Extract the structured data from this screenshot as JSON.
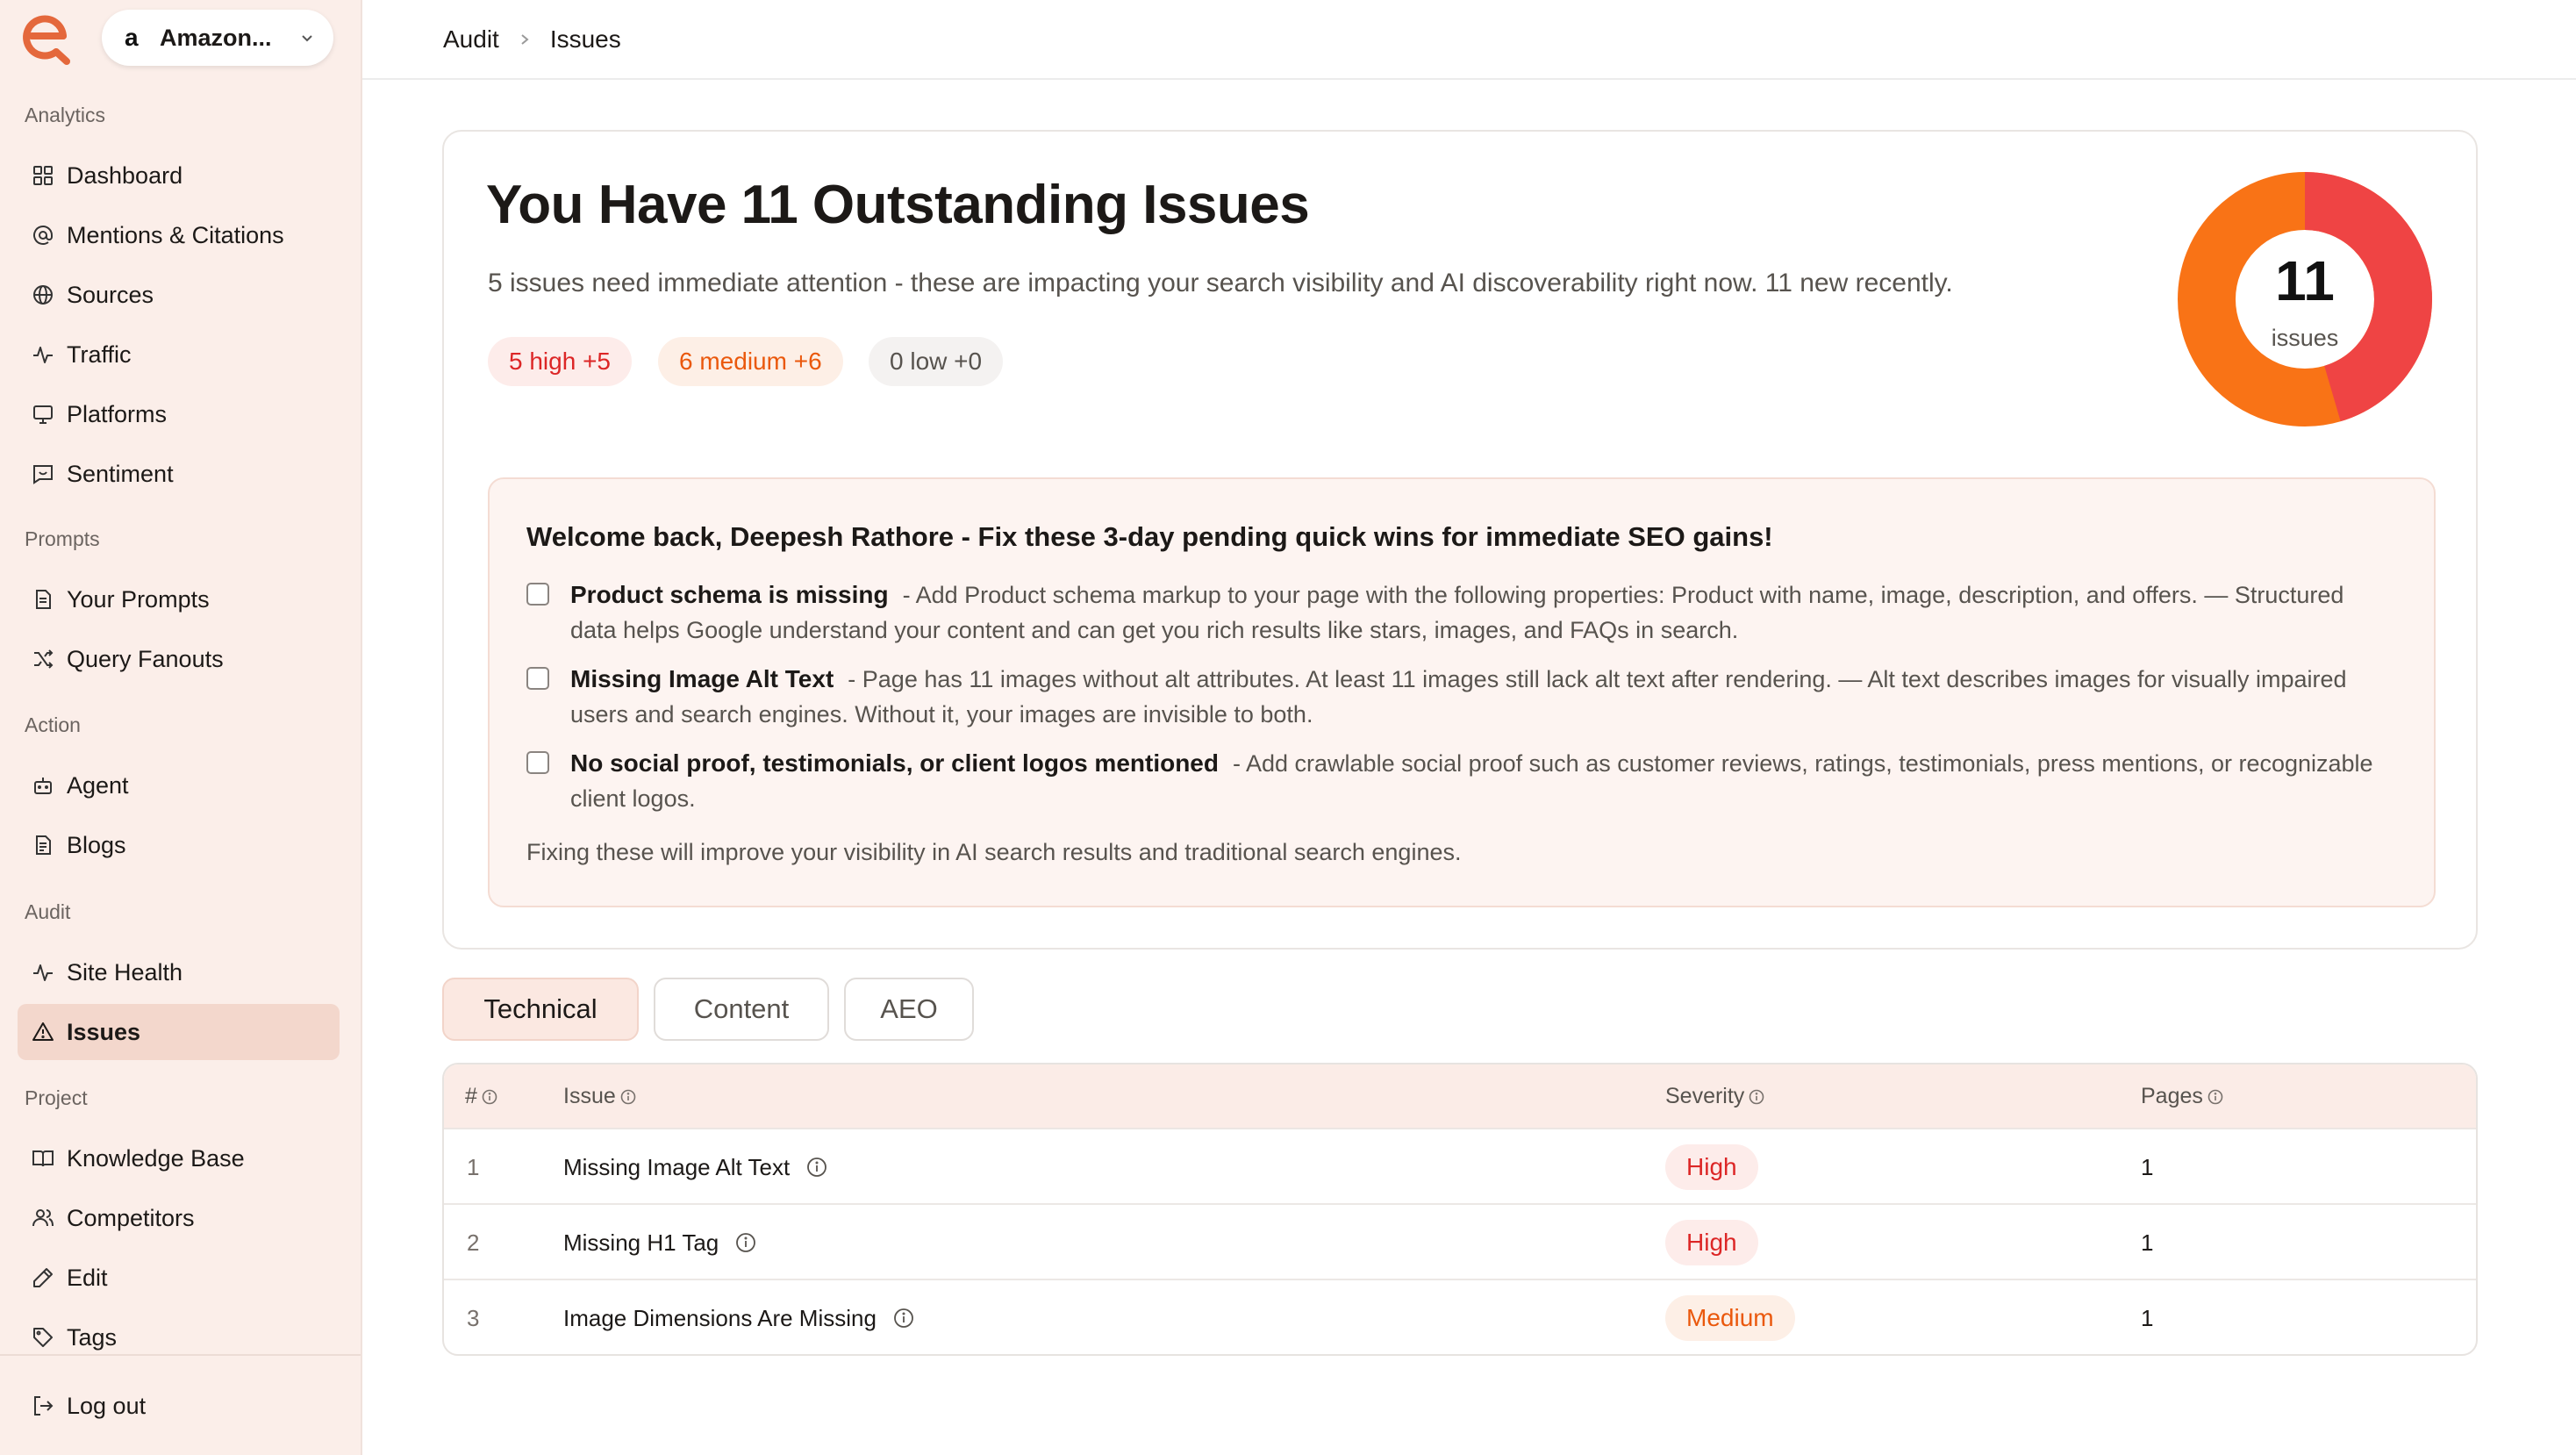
{
  "workspace": {
    "logo": "a",
    "name": "Amazon..."
  },
  "sidebar": {
    "sections": [
      {
        "label": "Analytics",
        "items": [
          "Dashboard",
          "Mentions & Citations",
          "Sources",
          "Traffic",
          "Platforms",
          "Sentiment"
        ]
      },
      {
        "label": "Prompts",
        "items": [
          "Your Prompts",
          "Query Fanouts"
        ]
      },
      {
        "label": "Action",
        "items": [
          "Agent",
          "Blogs"
        ]
      },
      {
        "label": "Audit",
        "items": [
          "Site Health",
          "Issues"
        ]
      },
      {
        "label": "Project",
        "items": [
          "Knowledge Base",
          "Competitors",
          "Edit",
          "Tags"
        ]
      }
    ],
    "active_item": "Issues",
    "logout": "Log out"
  },
  "breadcrumb": {
    "parent": "Audit",
    "current": "Issues"
  },
  "summary": {
    "title": "You Have 11 Outstanding Issues",
    "subtitle": "5 issues need immediate attention - these are impacting your search visibility and AI discoverability right now. 11 new recently.",
    "pills": {
      "high": "5 high +5",
      "medium": "6 medium +6",
      "low": "0 low +0"
    },
    "donut": {
      "total": "11",
      "label": "issues",
      "high": 5,
      "medium": 6,
      "low": 0,
      "colors": {
        "high": "#ef4444",
        "medium": "#f97316"
      }
    }
  },
  "welcome": {
    "heading": "Welcome back, Deepesh Rathore - Fix these 3-day pending quick wins for immediate SEO gains!",
    "tasks": [
      {
        "title": "Product schema is missing",
        "desc": "- Add Product schema markup to your page with the following properties: Product with name, image, description, and offers. — Structured data helps Google understand your content and can get you rich results like stars, images, and FAQs in search."
      },
      {
        "title": "Missing Image Alt Text",
        "desc": "- Page has 11 images without alt attributes. At least 11 images still lack alt text after rendering. — Alt text describes images for visually impaired users and search engines. Without it, your images are invisible to both."
      },
      {
        "title": "No social proof, testimonials, or client logos mentioned",
        "desc": "- Add crawlable social proof such as customer reviews, ratings, testimonials, press mentions, or recognizable client logos."
      }
    ],
    "footer": "Fixing these will improve your visibility in AI search results and traditional search engines."
  },
  "tabs": [
    "Technical",
    "Content",
    "AEO"
  ],
  "table": {
    "headers": {
      "num": "#",
      "issue": "Issue",
      "severity": "Severity",
      "pages": "Pages"
    },
    "rows": [
      {
        "num": "1",
        "issue": "Missing Image Alt Text",
        "severity": "High",
        "pages": "1"
      },
      {
        "num": "2",
        "issue": "Missing H1 Tag",
        "severity": "High",
        "pages": "1"
      },
      {
        "num": "3",
        "issue": "Image Dimensions Are Missing",
        "severity": "Medium",
        "pages": "1"
      }
    ]
  }
}
